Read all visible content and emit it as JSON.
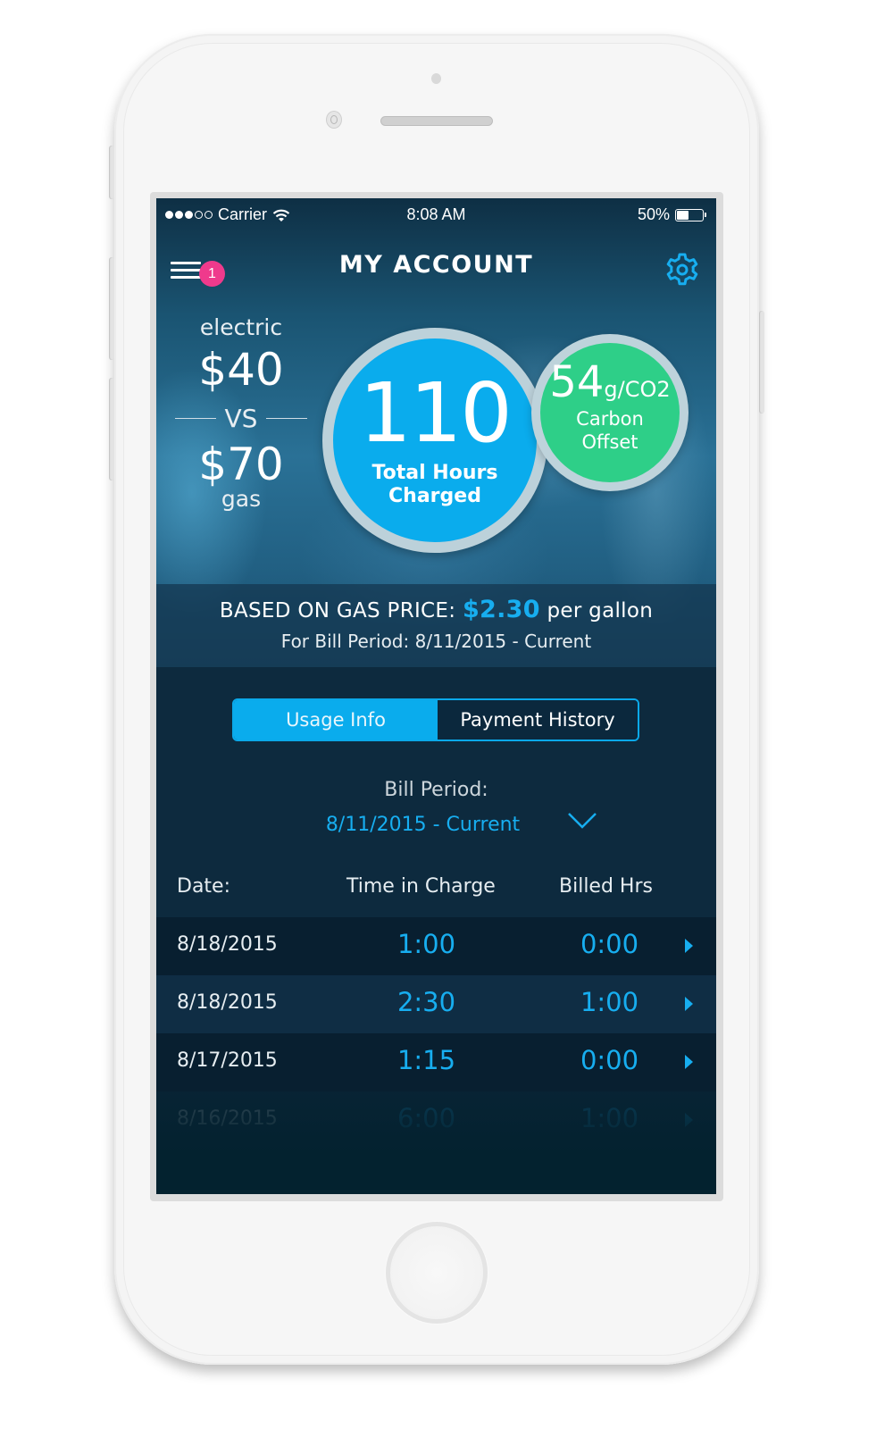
{
  "status_bar": {
    "carrier": "Carrier",
    "signal_dots": [
      true,
      true,
      true,
      false,
      false
    ],
    "time": "8:08 AM",
    "battery": "50%",
    "battery_level": 0.5
  },
  "nav": {
    "title": "MY ACCOUNT",
    "menu_icon": "hamburger-menu-icon",
    "notification_count": "1",
    "settings_icon": "gear-icon"
  },
  "comparison": {
    "electric_label": "electric",
    "electric_amount": "$40",
    "vs_label": "VS",
    "gas_amount": "$70",
    "gas_label": "gas"
  },
  "hours": {
    "value": "110",
    "label_line1": "Total Hours",
    "label_line2": "Charged"
  },
  "carbon": {
    "value": "54",
    "unit": "g/CO2",
    "label_line1": "Carbon",
    "label_line2": "Offset"
  },
  "gas_price": {
    "prefix": "BASED ON GAS PRICE:",
    "price": "$2.30",
    "suffix": "per gallon",
    "period_text": "For Bill Period: 8/11/2015 - Current"
  },
  "tabs": [
    {
      "label": "Usage Info",
      "active": true
    },
    {
      "label": "Payment History",
      "active": false
    }
  ],
  "bill_period": {
    "label": "Bill Period:",
    "selected": "8/11/2015 - Current",
    "dropdown_icon": "chevron-down-icon"
  },
  "table": {
    "headers": [
      "Date:",
      "Time in Charge",
      "Billed Hrs"
    ],
    "rows": [
      {
        "date": "8/18/2015",
        "time_in_charge": "1:00",
        "billed_hrs": "0:00"
      },
      {
        "date": "8/18/2015",
        "time_in_charge": "2:30",
        "billed_hrs": "1:00"
      },
      {
        "date": "8/17/2015",
        "time_in_charge": "1:15",
        "billed_hrs": "0:00"
      },
      {
        "date": "8/16/2015",
        "time_in_charge": "6:00",
        "billed_hrs": "1:00"
      }
    ]
  },
  "colors": {
    "accent_blue": "#0aaced",
    "carbon_green": "#2ecf88",
    "badge_pink": "#ef3a8c",
    "background_navy": "#0d2a3e"
  }
}
